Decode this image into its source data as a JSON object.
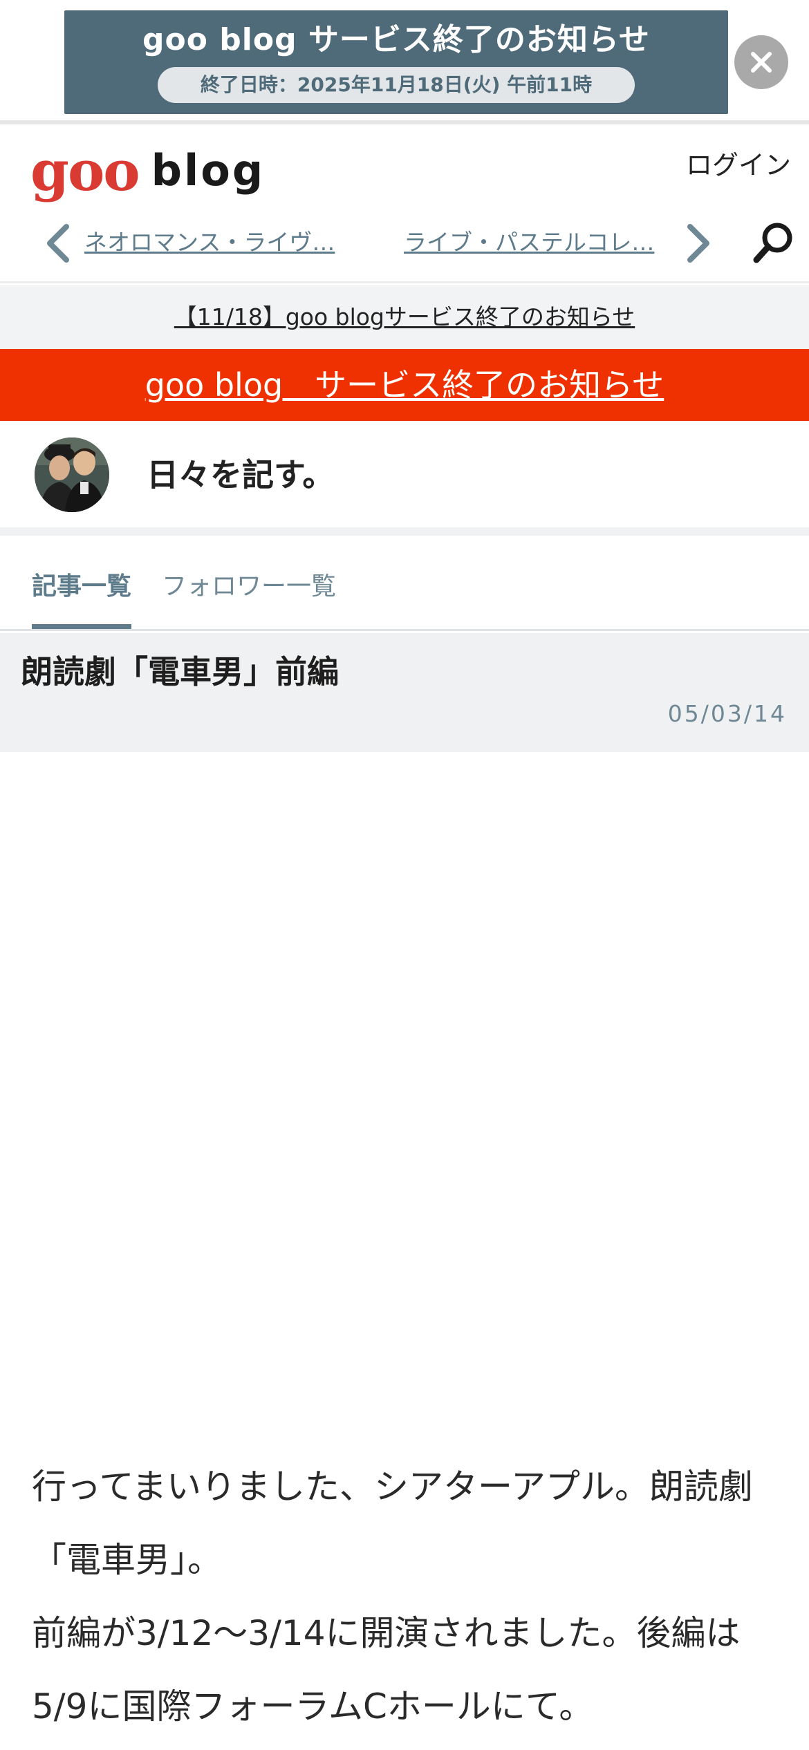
{
  "top_banner": {
    "title": "goo blog サービス終了のお知らせ",
    "subtitle": "終了日時：2025年11月18日(火) 午前11時",
    "close_icon": "close-icon"
  },
  "header": {
    "logo_goo": "goo",
    "logo_blog": "blog",
    "login": "ログイン",
    "nav": {
      "prev_icon": "chevron-left-icon",
      "items": [
        "ネオロマンス・ライヴ…",
        "ライブ・パステルコレ…"
      ],
      "next_icon": "chevron-right-icon",
      "search_icon": "search-icon"
    }
  },
  "notice": {
    "text": "【11/18】goo blogサービス終了のお知らせ"
  },
  "red_banner": {
    "text": "goo blog　サービス終了のお知らせ"
  },
  "blog": {
    "title": "日々を記す。",
    "avatar_icon": "avatar"
  },
  "tabs": [
    {
      "label": "記事一覧",
      "active": true
    },
    {
      "label": "フォロワー一覧",
      "active": false
    }
  ],
  "article": {
    "title": "朗読劇「電車男」前編",
    "date": "05/03/14",
    "body": [
      "行ってまいりました、シアターアプル。朗読劇「電車男」。",
      "前編が3/12～3/14に開演されました。後編は5/9に国際フォーラムCホールにて。"
    ]
  },
  "colors": {
    "red_banner": "#ef3000",
    "accent": "#5e7b8c",
    "logo_red": "#d93a32",
    "banner_bg": "#4f6a78"
  }
}
